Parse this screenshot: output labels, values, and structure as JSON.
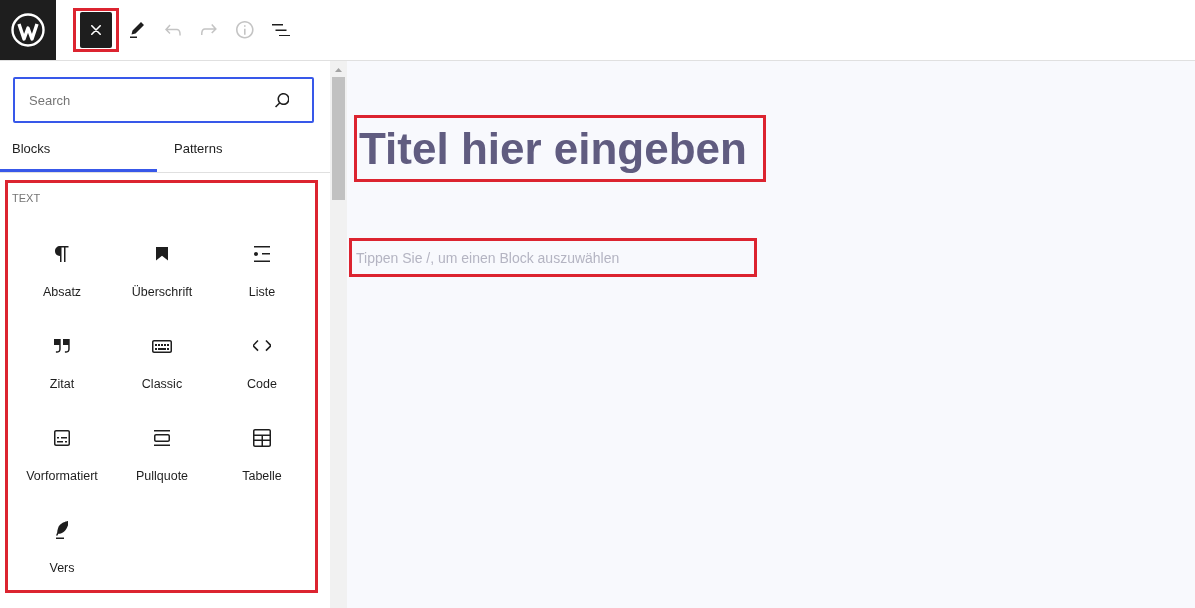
{
  "toolbar": {
    "buttons": [
      {
        "kind": "close",
        "pressed": true,
        "disabled": false,
        "highlighted": true
      },
      {
        "kind": "edit",
        "pressed": false,
        "disabled": false,
        "highlighted": false
      },
      {
        "kind": "undo",
        "pressed": false,
        "disabled": true,
        "highlighted": false
      },
      {
        "kind": "redo",
        "pressed": false,
        "disabled": true,
        "highlighted": false
      },
      {
        "kind": "info",
        "pressed": false,
        "disabled": true,
        "highlighted": false
      },
      {
        "kind": "list_view",
        "pressed": false,
        "disabled": false,
        "highlighted": false
      }
    ]
  },
  "inserter": {
    "search": {
      "placeholder": "Search"
    },
    "tabs": [
      {
        "label": "Blocks",
        "selected": true
      },
      {
        "label": "Patterns",
        "selected": false
      }
    ],
    "block_panel": {
      "highlighted": true,
      "category": "TEXT",
      "blocks": [
        {
          "kind": "paragraph",
          "label": "Absatz"
        },
        {
          "kind": "heading",
          "label": "Überschrift"
        },
        {
          "kind": "list",
          "label": "Liste"
        },
        {
          "kind": "quote",
          "label": "Zitat"
        },
        {
          "kind": "classic",
          "label": "Classic"
        },
        {
          "kind": "code",
          "label": "Code"
        },
        {
          "kind": "preformatted",
          "label": "Vorformatiert"
        },
        {
          "kind": "pullquote",
          "label": "Pullquote"
        },
        {
          "kind": "table",
          "label": "Tabelle"
        },
        {
          "kind": "verse",
          "label": "Vers"
        }
      ]
    }
  },
  "editor": {
    "title": {
      "placeholder": "Titel hier eingeben",
      "highlighted": true
    },
    "block": {
      "placeholder": "Tippen Sie /, um einen Block auszuwählen",
      "highlighted": true
    }
  }
}
